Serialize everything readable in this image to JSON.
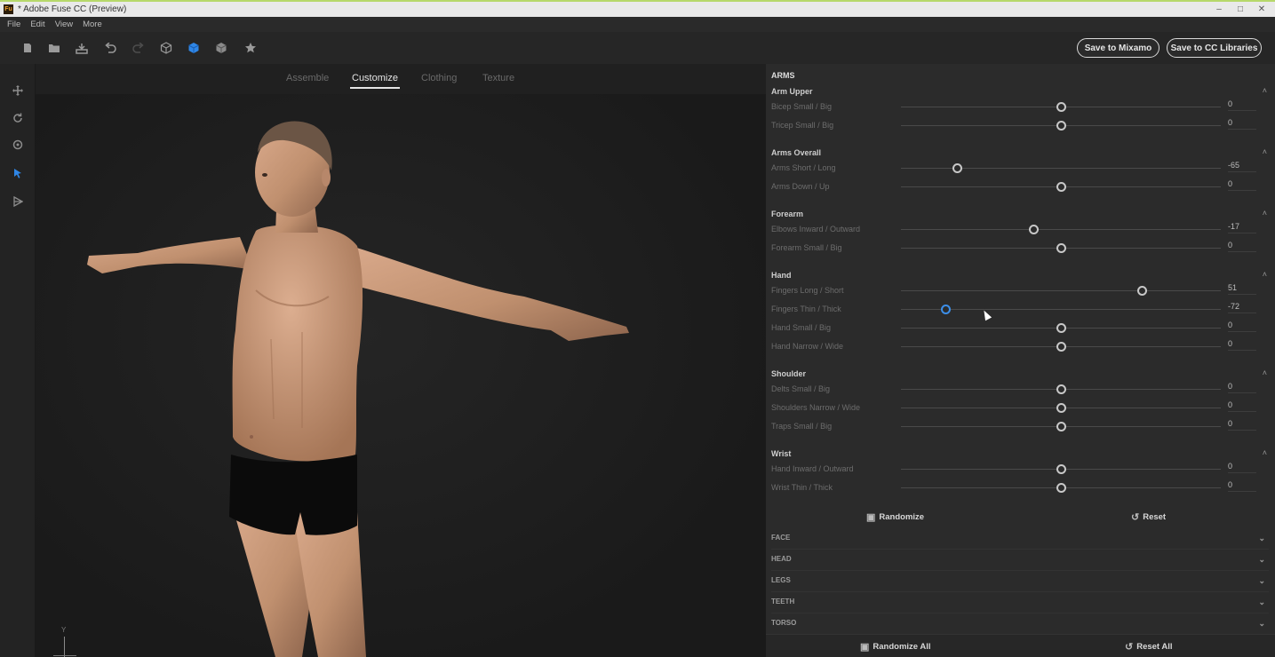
{
  "window": {
    "title": "* Adobe Fuse CC (Preview)",
    "app_icon_text": "Fu",
    "controls": [
      "–",
      "□",
      "✕"
    ]
  },
  "menu": [
    "File",
    "Edit",
    "View",
    "More"
  ],
  "toolbar": {
    "icons": [
      "new-file-icon",
      "open-folder-icon",
      "import-icon",
      "undo-icon",
      "redo-icon",
      "cube-outline-icon",
      "cube-active-icon",
      "cube-shaded-icon",
      "star-icon"
    ],
    "save_mixamo": "Save to Mixamo",
    "save_cc": "Save to CC Libraries"
  },
  "left_tools": [
    "move-icon",
    "rotate-icon",
    "orbit-icon",
    "select-arrow-icon",
    "pose-icon"
  ],
  "viewport": {
    "tabs": [
      "Assemble",
      "Customize",
      "Clothing",
      "Texture"
    ],
    "active_tab": "Customize",
    "axis_label": "Y"
  },
  "panel": {
    "section_title": "ARMS",
    "groups": [
      {
        "title": "Arm Upper",
        "sliders": [
          {
            "label": "Bicep Small / Big",
            "value": "0",
            "level": 0.0
          },
          {
            "label": "Tricep Small / Big",
            "value": "0",
            "level": 0.0
          }
        ]
      },
      {
        "title": "Arms Overall",
        "sliders": [
          {
            "label": "Arms Short / Long",
            "value": "-65",
            "level": -0.65
          },
          {
            "label": "Arms Down / Up",
            "value": "0",
            "level": 0.0
          }
        ]
      },
      {
        "title": "Forearm",
        "sliders": [
          {
            "label": "Elbows Inward / Outward",
            "value": "-17",
            "level": -0.17
          },
          {
            "label": "Forearm Small / Big",
            "value": "0",
            "level": 0.0
          }
        ]
      },
      {
        "title": "Hand",
        "sliders": [
          {
            "label": "Fingers Long / Short",
            "value": "51",
            "level": 0.51
          },
          {
            "label": "Fingers Thin / Thick",
            "value": "-72",
            "level": -0.72,
            "active": true
          },
          {
            "label": "Hand Small / Big",
            "value": "0",
            "level": 0.0
          },
          {
            "label": "Hand Narrow / Wide",
            "value": "0",
            "level": 0.0
          }
        ]
      },
      {
        "title": "Shoulder",
        "sliders": [
          {
            "label": "Delts Small / Big",
            "value": "0",
            "level": 0.0
          },
          {
            "label": "Shoulders Narrow / Wide",
            "value": "0",
            "level": 0.0
          },
          {
            "label": "Traps Small / Big",
            "value": "0",
            "level": 0.0
          }
        ]
      },
      {
        "title": "Wrist",
        "sliders": [
          {
            "label": "Hand Inward / Outward",
            "value": "0",
            "level": 0.0
          },
          {
            "label": "Wrist Thin / Thick",
            "value": "0",
            "level": 0.0
          }
        ]
      }
    ],
    "randomize_label": "Randomize",
    "reset_label": "Reset",
    "collapsed_sections": [
      "FACE",
      "HEAD",
      "LEGS",
      "TEETH",
      "TORSO"
    ],
    "randomize_all_label": "Randomize All",
    "reset_all_label": "Reset All"
  },
  "colors": {
    "accent": "#2f86e6",
    "panel_bg": "#2b2b2b",
    "viewport_bg": "#1c1c1c",
    "skin": "#c59478",
    "briefs": "#0b0b0b"
  }
}
